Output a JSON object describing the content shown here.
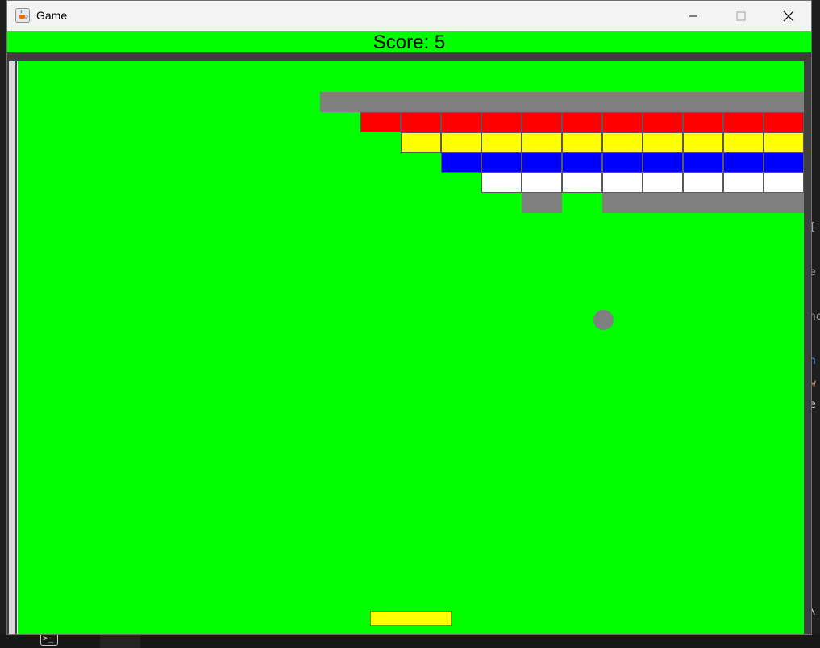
{
  "window": {
    "title": "Game",
    "app_icon": "java-coffee-cup-icon",
    "controls": {
      "minimize_icon": "minimize-icon",
      "maximize_icon": "maximize-icon",
      "close_icon": "close-icon"
    }
  },
  "game": {
    "score_text": "Score: 5",
    "colors": {
      "background": "#00ff00",
      "gray_brick": "#808080",
      "red_brick": "#ff0000",
      "yellow_brick": "#ffff00",
      "blue_brick": "#0000ff",
      "white_brick": "#ffffff",
      "ball": "#808080",
      "paddle": "#ffff00",
      "wall": "#3f3f3f"
    },
    "brick_rows": [
      {
        "color": "gray",
        "count": 12
      },
      {
        "color": "red",
        "count": 11
      },
      {
        "color": "yellow",
        "count": 10
      },
      {
        "color": "blue",
        "count": 9
      },
      {
        "color": "white",
        "count": 8
      },
      {
        "color": "gray",
        "count": 6
      }
    ]
  },
  "ide_background": {
    "side_glyphs": [
      "[",
      "e",
      "no",
      "n",
      "w",
      "e",
      "\\"
    ],
    "terminal_icon": "terminal-icon"
  }
}
